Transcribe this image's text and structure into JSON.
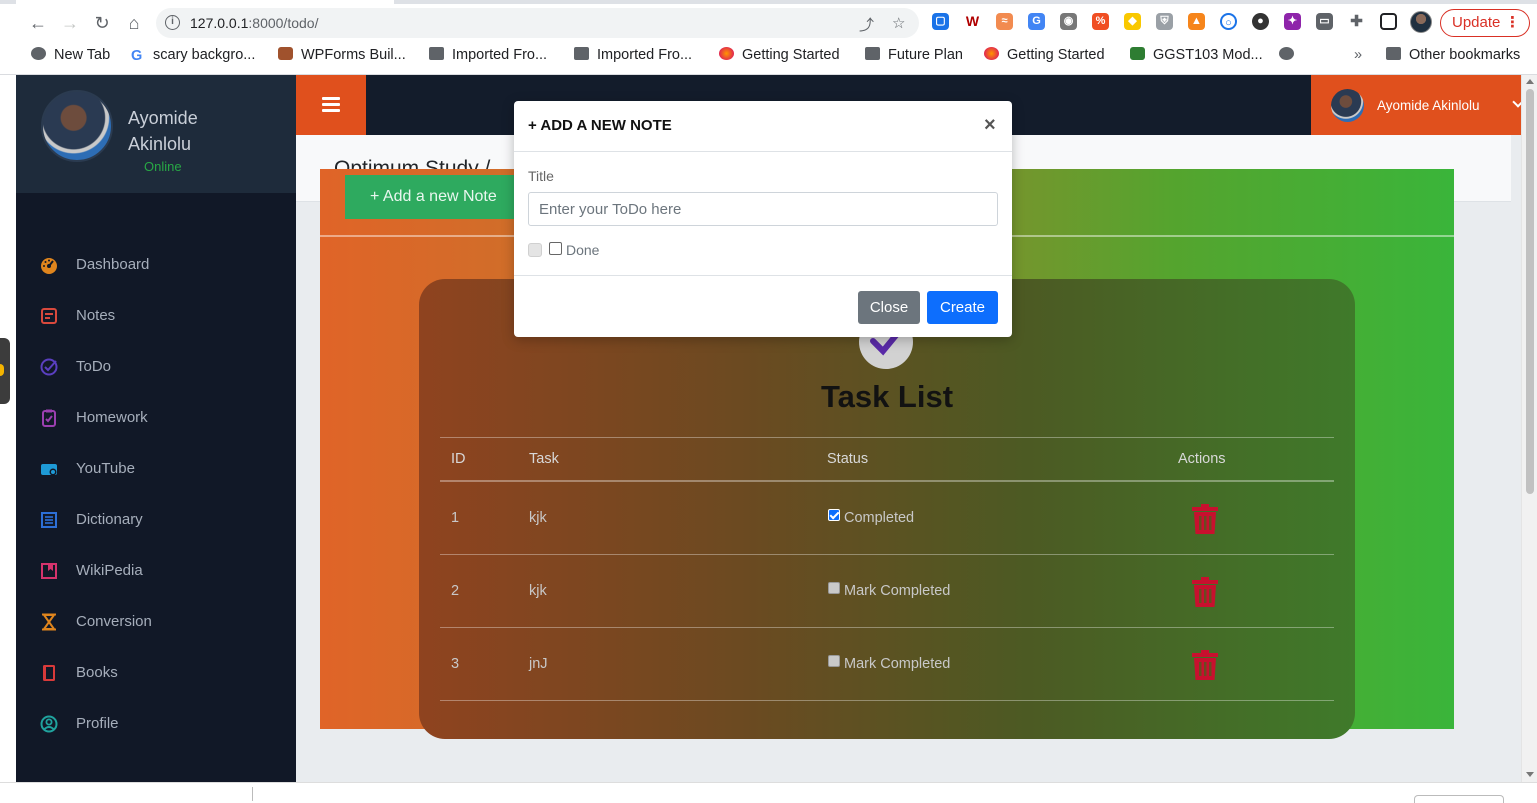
{
  "browser": {
    "url_host": "127.0.0.1",
    "url_path": ":8000/todo/",
    "update_label": "Update",
    "bookmarks": [
      "New Tab",
      "scary backgro...",
      "WPForms Buil...",
      "Imported Fro...",
      "Imported Fro...",
      "Getting Started",
      "Future Plan",
      "Getting Started",
      "GGST103 Mod...",
      "Other bookmarks"
    ],
    "overflow_label": "»"
  },
  "sidebar": {
    "user_name": "Ayomide Akinlolu",
    "user_status": "Online",
    "items": [
      {
        "label": "Dashboard",
        "icon": "tachometer-icon",
        "color": "#e0851d"
      },
      {
        "label": "Notes",
        "icon": "note-icon",
        "color": "#d9493d"
      },
      {
        "label": "ToDo",
        "icon": "check-circle-icon",
        "color": "#5a3fc0"
      },
      {
        "label": "Homework",
        "icon": "clipboard-check-icon",
        "color": "#9b3fb0"
      },
      {
        "label": "YouTube",
        "icon": "video-icon",
        "color": "#1e9ad6"
      },
      {
        "label": "Dictionary",
        "icon": "book-list-icon",
        "color": "#2d6fd6"
      },
      {
        "label": "WikiPedia",
        "icon": "bookmark-book-icon",
        "color": "#d6336c"
      },
      {
        "label": "Conversion",
        "icon": "hourglass-icon",
        "color": "#e0851d"
      },
      {
        "label": "Books",
        "icon": "book-icon",
        "color": "#d93a3a"
      },
      {
        "label": "Profile",
        "icon": "user-circle-icon",
        "color": "#20a39e"
      }
    ]
  },
  "topbar": {
    "user_name": "Ayomide Akinlolu"
  },
  "header": {
    "breadcrumb": "Optimum Study /"
  },
  "main": {
    "add_button_label": "+ Add a new Note",
    "task_list_title": "Task List",
    "columns": [
      "ID",
      "Task",
      "Status",
      "Actions"
    ],
    "rows": [
      {
        "id": "1",
        "task": "kjk",
        "status": "Completed",
        "checked": true
      },
      {
        "id": "2",
        "task": "kjk",
        "status": "Mark Completed",
        "checked": false
      },
      {
        "id": "3",
        "task": "jnJ",
        "status": "Mark Completed",
        "checked": false
      }
    ]
  },
  "modal": {
    "title": "+ ADD A NEW NOTE",
    "close_x": "×",
    "field_label": "Title",
    "placeholder": "Enter your ToDo here",
    "done_label": "Done",
    "close_label": "Close",
    "create_label": "Create"
  },
  "colors": {
    "accent_orange": "#e0501d",
    "sidebar_bg": "#111827",
    "primary_blue": "#0d6efd",
    "secondary_gray": "#6c757d",
    "delete_red": "#c8102e",
    "online_green": "#28a745"
  }
}
